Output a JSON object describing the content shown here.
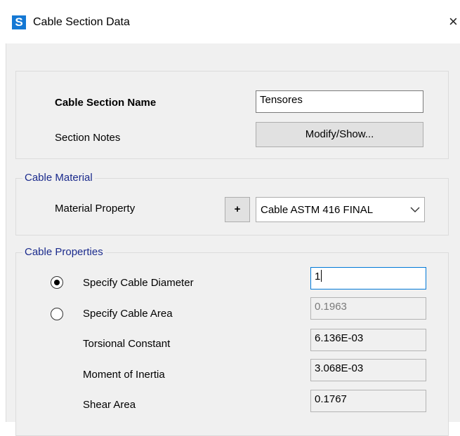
{
  "window": {
    "app_icon_letter": "S",
    "title": "Cable Section Data",
    "close_glyph": "×"
  },
  "section": {
    "name_label": "Cable Section Name",
    "name_value": "Tensores",
    "notes_label": "Section Notes",
    "notes_button": "Modify/Show..."
  },
  "material": {
    "group_title": "Cable Material",
    "property_label": "Material Property",
    "add_button": "+",
    "selected": "Cable ASTM 416 FINAL"
  },
  "properties": {
    "group_title": "Cable Properties",
    "diameter_option": {
      "label": "Specify Cable Diameter",
      "selected": true,
      "value": "1"
    },
    "area_option": {
      "label": "Specify Cable Area",
      "selected": false,
      "value": "0.1963"
    },
    "torsional": {
      "label": "Torsional Constant",
      "value": "6.136E-03"
    },
    "inertia": {
      "label": "Moment of Inertia",
      "value": "3.068E-03"
    },
    "shear": {
      "label": "Shear Area",
      "value": "0.1767"
    }
  },
  "colors": {
    "icon_blue": "#1478d4",
    "legend_blue": "#1a2a8c",
    "focus_border": "#0078d7",
    "dialog_bg": "#f0f0f0"
  }
}
